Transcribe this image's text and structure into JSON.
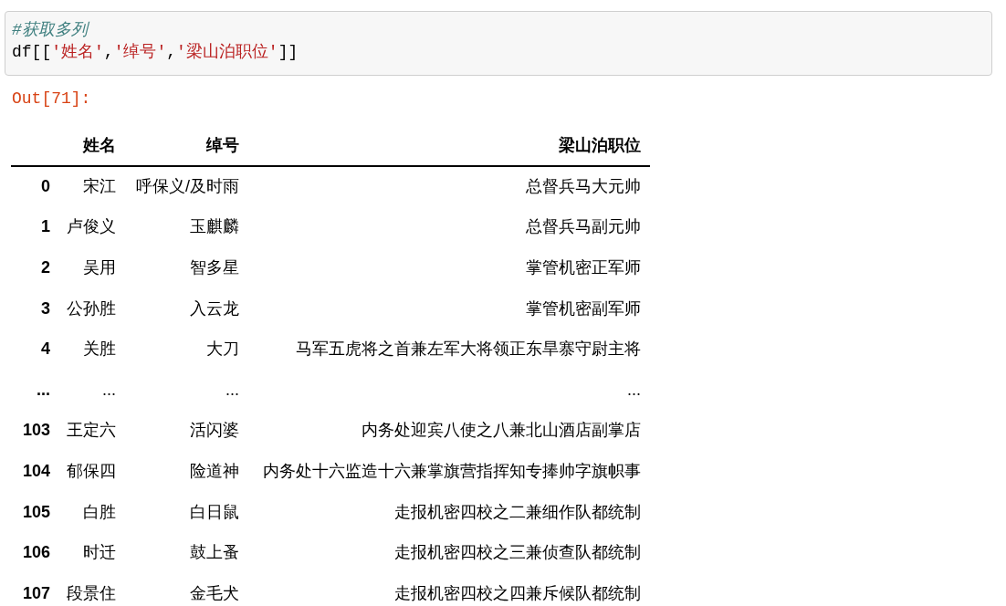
{
  "code_cell": {
    "lines": [
      {
        "tokens": [
          {
            "kind": "comment",
            "text": "#获取多列"
          }
        ]
      },
      {
        "tokens": [
          {
            "kind": "plain",
            "text": "df[["
          },
          {
            "kind": "string",
            "text": "'姓名'"
          },
          {
            "kind": "plain",
            "text": ","
          },
          {
            "kind": "string",
            "text": "'绰号'"
          },
          {
            "kind": "plain",
            "text": ","
          },
          {
            "kind": "string",
            "text": "'梁山泊职位'"
          },
          {
            "kind": "plain",
            "text": "]]"
          }
        ]
      }
    ]
  },
  "output": {
    "prompt": "Out[71]:",
    "table": {
      "columns": [
        "姓名",
        "绰号",
        "梁山泊职位"
      ],
      "rows": [
        {
          "index": "0",
          "cells": [
            "宋江",
            "呼保义/及时雨",
            "总督兵马大元帅"
          ]
        },
        {
          "index": "1",
          "cells": [
            "卢俊义",
            "玉麒麟",
            "总督兵马副元帅"
          ]
        },
        {
          "index": "2",
          "cells": [
            "吴用",
            "智多星",
            "掌管机密正军师"
          ]
        },
        {
          "index": "3",
          "cells": [
            "公孙胜",
            "入云龙",
            "掌管机密副军师"
          ]
        },
        {
          "index": "4",
          "cells": [
            "关胜",
            "大刀",
            "马军五虎将之首兼左军大将领正东旱寨守尉主将"
          ]
        },
        {
          "index": "...",
          "cells": [
            "...",
            "...",
            "..."
          ]
        },
        {
          "index": "103",
          "cells": [
            "王定六",
            "活闪婆",
            "内务处迎宾八使之八兼北山酒店副掌店"
          ]
        },
        {
          "index": "104",
          "cells": [
            "郁保四",
            "险道神",
            "内务处十六监造十六兼掌旗营指挥知专捧帅字旗帜事"
          ]
        },
        {
          "index": "105",
          "cells": [
            "白胜",
            "白日鼠",
            "走报机密四校之二兼细作队都统制"
          ]
        },
        {
          "index": "106",
          "cells": [
            "时迁",
            "鼓上蚤",
            "走报机密四校之三兼侦查队都统制"
          ]
        },
        {
          "index": "107",
          "cells": [
            "段景住",
            "金毛犬",
            "走报机密四校之四兼斥候队都统制"
          ]
        }
      ]
    }
  }
}
